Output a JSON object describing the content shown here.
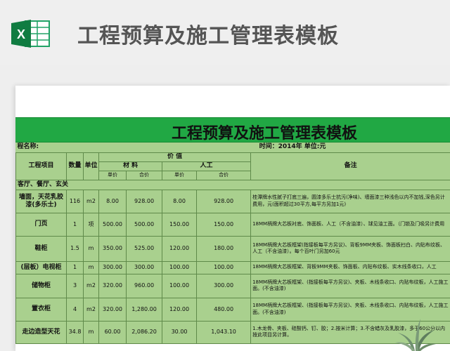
{
  "header": {
    "app_icon": "excel-icon",
    "title": "工程预算及施工管理表模板"
  },
  "sheet": {
    "title": "工程预算及施工管理表模板",
    "info_row": {
      "project_name_label": "程名称:",
      "time_unit": "时间：2014年     单位:元"
    },
    "headers": {
      "item": "工程项目",
      "qty": "数量",
      "unit": "单位",
      "price": "价    值",
      "material": "材    料",
      "labor": "人工",
      "unit_price": "单价",
      "total": "合价",
      "remark": "备注"
    },
    "section": "客厅、餐厅、玄关",
    "rows": [
      {
        "item": "墙面，天花乳胶漆(多乐士)",
        "qty": "116",
        "unit": "m2",
        "mat_price": "8.00",
        "mat_total": "928.00",
        "lab_price": "8.00",
        "lab_total": "928.00",
        "note": "桂潭牌水性腻子打底三遍，圆漆多乐士抗污(净味)、墙面漆三种浅色以内不加钱,深色另计费用，元(面积超过30平方,每平方另加1元)"
      },
      {
        "item": "门页",
        "qty": "1",
        "unit": "项",
        "mat_price": "500.00",
        "mat_total": "500.00",
        "lab_price": "150.00",
        "lab_total": "150.00",
        "note": "18MM柄牌大芯板衬底、饰面板、人工（不含油漆）、球见油工面。（门锁及门吸另计费用"
      },
      {
        "item": "鞋柜",
        "qty": "1.5",
        "unit": "m",
        "mat_price": "350.00",
        "mat_total": "525.00",
        "lab_price": "120.00",
        "lab_total": "180.00",
        "note": "18MM柄牌大芯板框架(指接板每平方另议)、背板9MM夹板、饰面板扫白、内贴布纹板、人工（不含油漆）。每个百叶门另加60元"
      },
      {
        "item": "(层板）电视柜",
        "qty": "1",
        "unit": "m",
        "mat_price": "300.00",
        "mat_total": "300.00",
        "lab_price": "100.00",
        "lab_total": "100.00",
        "note": "18MM柄牌大芯板框架、背板9MM夹板、饰面板、内贴布纹板、实木线条收口，人工"
      },
      {
        "item": "储物柜",
        "qty": "3",
        "unit": "m2",
        "mat_price": "320.00",
        "mat_total": "960.00",
        "lab_price": "100.00",
        "lab_total": "300.00",
        "note": "18MM柄牌大芯板框架、(指接板每平方另议)、夹板、木线条收口、内贴布纹板，人工施工面。(不含油漆)"
      },
      {
        "item": "置衣柜",
        "qty": "4",
        "unit": "m2",
        "mat_price": "320.00",
        "mat_total": "1,280.00",
        "lab_price": "120.00",
        "lab_total": "480.00",
        "note": "18MM柄牌大芯板框架、(指接板每平方另议)、夹板、木线条收口、内贴布纹板，人工施工面。(不含油漆)"
      },
      {
        "item": "走边造型天花",
        "qty": "34.8",
        "unit": "m",
        "mat_price": "60.00",
        "mat_total": "2,086.20",
        "lab_price": "30.00",
        "lab_total": "1,043.10",
        "note": "1.木龙骨、夹板、硅酸钙、钉、胶；2.按米计算；3.不含蜡灰及乳胶漆，多于60公分以内按此项目另计算。"
      }
    ]
  },
  "colors": {
    "title_band": "#21a844",
    "grid_fill": "#a9d08e",
    "grid_line": "#5f8a4a",
    "header_text": "#555555"
  }
}
